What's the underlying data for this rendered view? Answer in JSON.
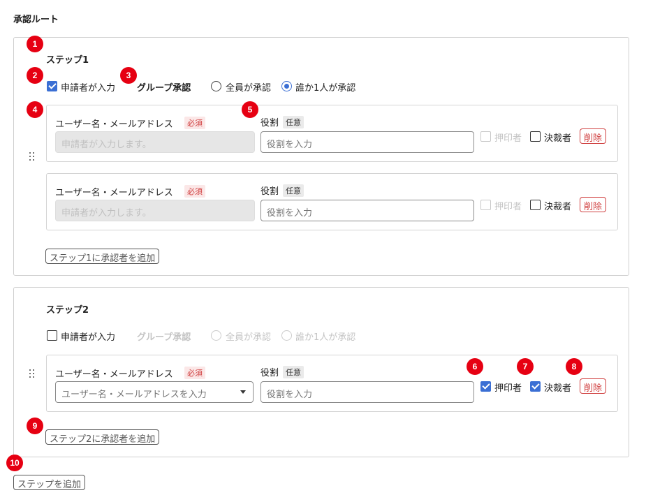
{
  "section_title": "承認ルート",
  "steps": [
    {
      "title": "ステップ1",
      "applicant_input_label": "申請者が入力",
      "applicant_input_checked": true,
      "group_label": "グループ承認",
      "radio_all": "全員が承認",
      "radio_any": "誰か1人が承認",
      "radio_selected": "any",
      "rows": [
        {
          "user_label": "ユーザー名・メールアドレス",
          "required_badge": "必須",
          "user_placeholder": "申請者が入力します。",
          "role_label": "役割",
          "optional_badge": "任意",
          "role_placeholder": "役割を入力",
          "stamper_label": "押印者",
          "stamper_checked": false,
          "decider_label": "決裁者",
          "decider_checked": false,
          "delete_label": "削除"
        },
        {
          "user_label": "ユーザー名・メールアドレス",
          "required_badge": "必須",
          "user_placeholder": "申請者が入力します。",
          "role_label": "役割",
          "optional_badge": "任意",
          "role_placeholder": "役割を入力",
          "stamper_label": "押印者",
          "stamper_checked": false,
          "decider_label": "決裁者",
          "decider_checked": false,
          "delete_label": "削除"
        }
      ],
      "add_approver_label": "ステップ1に承認者を追加"
    },
    {
      "title": "ステップ2",
      "applicant_input_label": "申請者が入力",
      "applicant_input_checked": false,
      "group_label": "グループ承認",
      "radio_all": "全員が承認",
      "radio_any": "誰か1人が承認",
      "rows": [
        {
          "user_label": "ユーザー名・メールアドレス",
          "required_badge": "必須",
          "user_placeholder": "ユーザー名・メールアドレスを入力",
          "role_label": "役割",
          "optional_badge": "任意",
          "role_placeholder": "役割を入力",
          "stamper_label": "押印者",
          "stamper_checked": true,
          "decider_label": "決裁者",
          "decider_checked": true,
          "delete_label": "削除"
        }
      ],
      "add_approver_label": "ステップ2に承認者を追加"
    }
  ],
  "add_step_label": "ステップを追加",
  "markers": [
    "1",
    "2",
    "3",
    "4",
    "5",
    "6",
    "7",
    "8",
    "9",
    "10"
  ],
  "colors": {
    "accent": "#3b6fd4",
    "danger": "#d04040",
    "marker": "#e60012"
  }
}
